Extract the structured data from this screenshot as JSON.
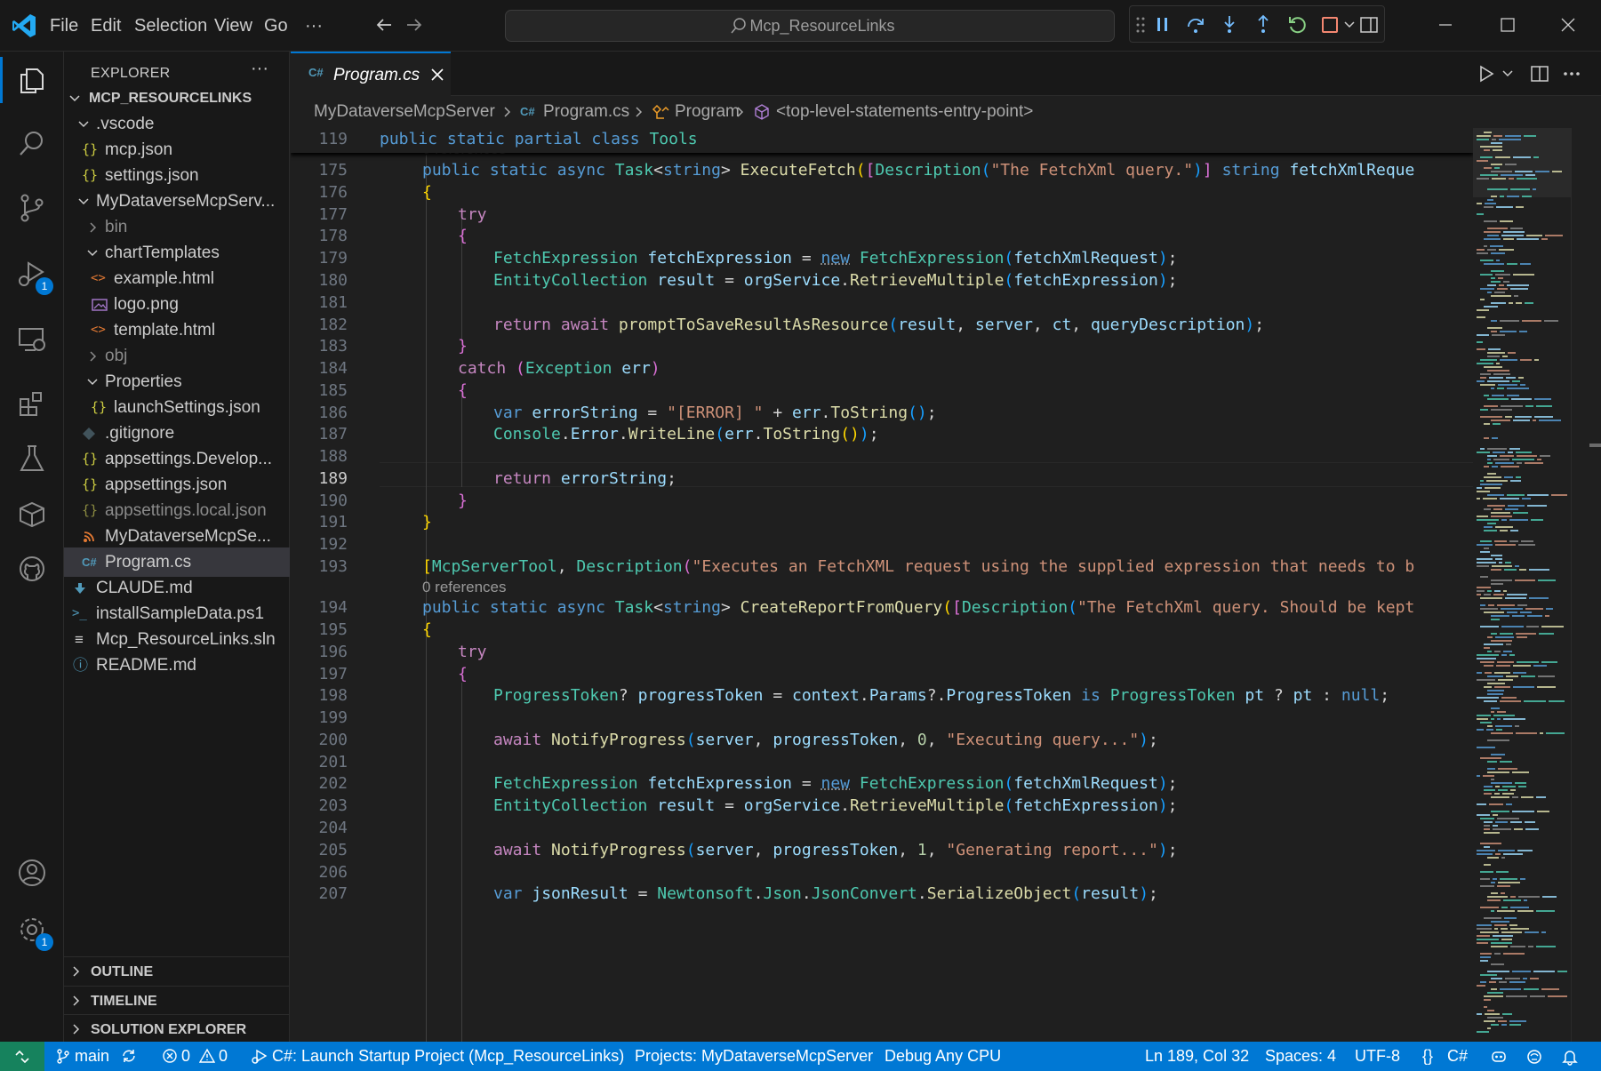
{
  "titlebar": {
    "menu": [
      "File",
      "Edit",
      "Selection",
      "View",
      "Go",
      "···"
    ],
    "search_text": "Mcp_ResourceLinks"
  },
  "activity": {
    "run_badge": "1",
    "settings_badge": "1"
  },
  "sidebar": {
    "title": "EXPLORER",
    "more": "···",
    "root": "MCP_RESOURCELINKS",
    "items": [
      {
        "label": ".vscode",
        "icon": ""
      },
      {
        "label": "mcp.json",
        "icon": "{}"
      },
      {
        "label": "settings.json",
        "icon": "{}"
      },
      {
        "label": "MyDataverseMcpServ...",
        "icon": ""
      },
      {
        "label": "bin",
        "icon": ""
      },
      {
        "label": "chartTemplates",
        "icon": ""
      },
      {
        "label": "example.html",
        "icon": "<>"
      },
      {
        "label": "logo.png",
        "icon": ""
      },
      {
        "label": "template.html",
        "icon": "<>"
      },
      {
        "label": "obj",
        "icon": ""
      },
      {
        "label": "Properties",
        "icon": ""
      },
      {
        "label": "launchSettings.json",
        "icon": "{}"
      },
      {
        "label": ".gitignore",
        "icon": ""
      },
      {
        "label": "appsettings.Develop...",
        "icon": "{}"
      },
      {
        "label": "appsettings.json",
        "icon": "{}"
      },
      {
        "label": "appsettings.local.json",
        "icon": "{}"
      },
      {
        "label": "MyDataverseMcpSe...",
        "icon": ""
      },
      {
        "label": "Program.cs",
        "icon": "C#"
      },
      {
        "label": "CLAUDE.md",
        "icon": ""
      },
      {
        "label": "installSampleData.ps1",
        "icon": ">_"
      },
      {
        "label": "Mcp_ResourceLinks.sln",
        "icon": "≡"
      },
      {
        "label": "README.md",
        "icon": "ⓘ"
      }
    ],
    "sections": [
      "OUTLINE",
      "TIMELINE",
      "SOLUTION EXPLORER"
    ]
  },
  "editor": {
    "tab_label": "Program.cs",
    "tab_icon": "C#",
    "breadcrumb": [
      "MyDataverseMcpServer",
      "Program.cs",
      "Program",
      "<top-level-statements-entry-point>"
    ],
    "sticky_line_number": "119",
    "sticky_code": "public static partial class Tools",
    "references_label": "0 references",
    "current_line": "189",
    "line_numbers": [
      "175",
      "176",
      "177",
      "178",
      "179",
      "180",
      "181",
      "182",
      "183",
      "184",
      "185",
      "186",
      "187",
      "188",
      "189",
      "190",
      "191",
      "192",
      "193",
      "194",
      "195",
      "196",
      "197",
      "198",
      "199",
      "200",
      "201",
      "202",
      "203",
      "204",
      "205",
      "206",
      "207"
    ]
  },
  "statusbar": {
    "branch": "main",
    "errors": "0",
    "warnings": "0",
    "launch": "C#: Launch Startup Project (Mcp_ResourceLinks)",
    "projects": "Projects: MyDataverseMcpServer",
    "config": "Debug Any CPU",
    "position": "Ln 189, Col 32",
    "spaces": "Spaces: 4",
    "encoding": "UTF-8",
    "language": "C#",
    "language_braces": "{}"
  },
  "colors": {
    "accent": "#0078d4",
    "background": "#1f1f1f",
    "sidebar": "#181818",
    "keyword": "#569cd6",
    "type": "#4ec9b0",
    "function": "#dcdcaa",
    "string": "#ce9178"
  }
}
